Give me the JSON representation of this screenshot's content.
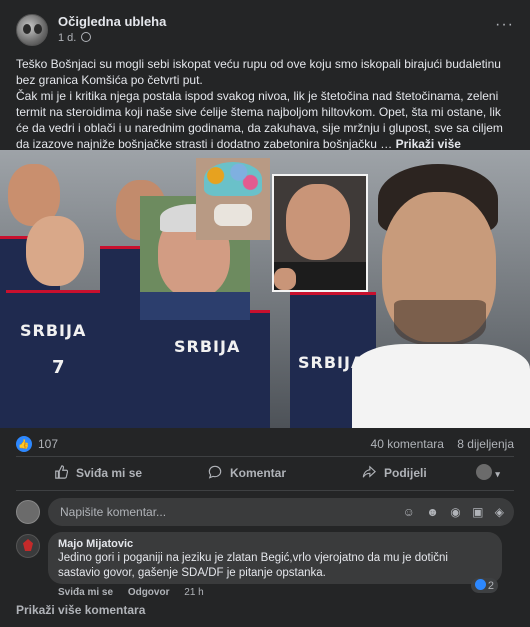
{
  "post": {
    "author": "Očigledna ubleha",
    "time": "1 d.",
    "more": "···",
    "paragraph1": "Teško Bošnjaci su mogli sebi iskopat veću rupu od ove koju smo iskopali birajući budaletinu bez granica Komšića po četvrti put.",
    "paragraph2": "Čak mi je i kritika njega postala ispod svakog nivoa, lik je štetočina nad štetočinama, zeleni termit na steroidima koji naše sive ćelije štema najboljom hiltovkom. Opet, šta mi ostane, lik će da vedri i oblači i u narednim godinama, da zakuhava, sije mržnju i glupost, sve sa ciljem da izazove najniže bošnjačke strasti i dodatno zabetonira bošnjačku …",
    "see_more": "Prikaži više"
  },
  "photo": {
    "jersey_text": "SRBIJA",
    "jersey_number": "7"
  },
  "reactions": {
    "like_icon": "👍",
    "count": "107",
    "comments": "40 komentara",
    "shares": "8 dijeljenja"
  },
  "actions": {
    "like": "Sviđa mi se",
    "comment": "Komentar",
    "share": "Podijeli"
  },
  "comment_box": {
    "placeholder": "Napišite komentar..."
  },
  "comment": {
    "name": "Majo Mijatovic",
    "text": "Jedino gori i poganiji na jeziku je zlatan Begić,vrlo vjerojatno da mu je dotični sastavio govor, gašenje SDA/DF je pitanje opstanka.",
    "like": "Sviđa mi se",
    "reply": "Odgovor",
    "time": "21 h",
    "reactions": "2"
  },
  "more_comments": "Prikaži više komentara",
  "colors": {
    "background": "#242526",
    "accent": "#2d88ff",
    "jersey": "#1f2a4f"
  }
}
